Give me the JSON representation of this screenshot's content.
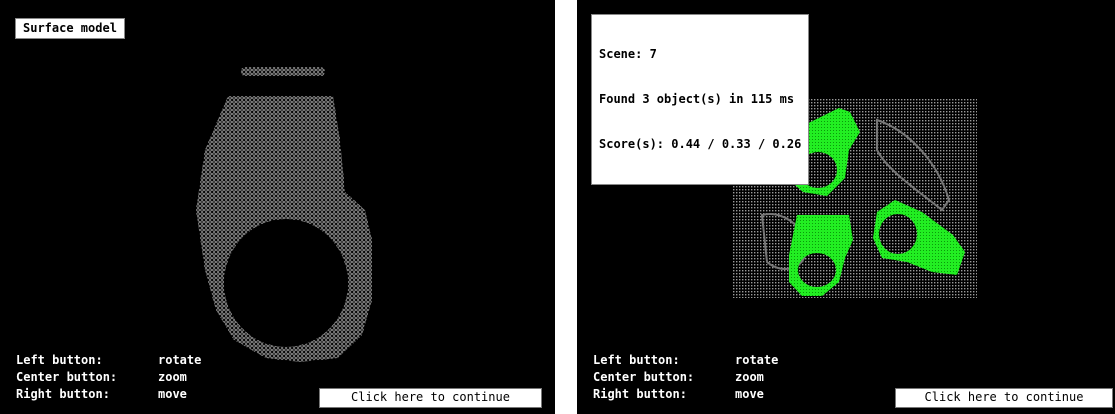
{
  "left_window": {
    "title": "Surface model",
    "controls": [
      {
        "button": "Left button:",
        "action": "rotate"
      },
      {
        "button": "Center button:",
        "action": "zoom"
      },
      {
        "button": "Right button:",
        "action": "move"
      }
    ],
    "continue_label": "Click here to continue"
  },
  "right_window": {
    "info_lines": [
      "Scene: 7",
      "Found 3 object(s) in 115 ms",
      "Score(s): 0.44 / 0.33 / 0.26"
    ],
    "controls": [
      {
        "button": "Left button:",
        "action": "rotate"
      },
      {
        "button": "Center button:",
        "action": "zoom"
      },
      {
        "button": "Right button:",
        "action": "move"
      }
    ],
    "continue_label": "Click here to continue"
  },
  "colors": {
    "background": "#000000",
    "model_points": "#d9d9d9",
    "scene_points": "#9a9a9a",
    "match_highlight": "#22ee22"
  }
}
